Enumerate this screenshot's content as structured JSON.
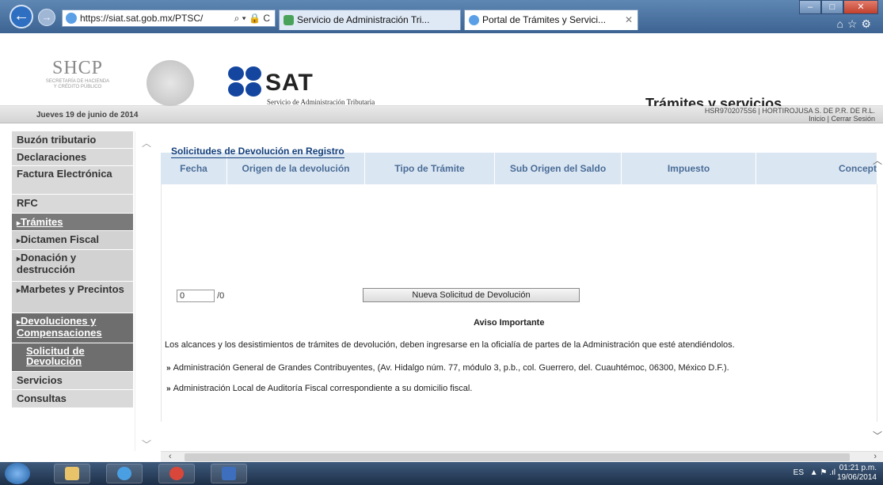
{
  "browser": {
    "url": "https://siat.sat.gob.mx/PTSC/",
    "url_controls": "⌕ ▾ 🔒 C",
    "tabs": [
      {
        "label": "Servicio de Administración Tri...",
        "active": false
      },
      {
        "label": "Portal de Trámites y Servici...",
        "active": true
      }
    ],
    "tab_close": "✕"
  },
  "header": {
    "shcp_big": "SHCP",
    "shcp_small_1": "SECRETARÍA DE HACIENDA",
    "shcp_small_2": "Y CRÉDITO PÚBLICO",
    "sat_logo": "SAT",
    "sat_subtitle": "Servicio de Administración Tributaria",
    "title": "Trámites y servicios"
  },
  "datebar": {
    "date": "Jueves 19 de junio de 2014",
    "user": "HSR9702075S6 | HORTIROJUSA S. DE P.R. DE R.L.",
    "inicio": "Inicio",
    "sep": "|",
    "cerrar": "Cerrar Sesión"
  },
  "sidebar": {
    "items": [
      {
        "label": "Buzón tributario"
      },
      {
        "label": "Declaraciones"
      },
      {
        "label": "Factura Electrónica"
      },
      {
        "label": "RFC"
      },
      {
        "label": "Trámites"
      },
      {
        "label": "Dictamen Fiscal"
      },
      {
        "label": "Donación y destrucción"
      },
      {
        "label": "Marbetes y Precintos"
      },
      {
        "label": "Devoluciones y Compensaciones"
      },
      {
        "label": "Solicitud de Devolución"
      },
      {
        "label": "Servicios"
      },
      {
        "label": "Consultas"
      }
    ]
  },
  "main": {
    "section_title": "Solicitudes de Devolución en Registro",
    "columns": [
      "Fecha",
      "Origen de la devolución",
      "Tipo de Trámite",
      "Sub Origen del Saldo",
      "Impuesto",
      "Concept"
    ],
    "pager_value": "0",
    "pager_total": "/0",
    "new_button": "Nueva Solicitud de Devolución",
    "aviso_title": "Aviso Importante",
    "aviso_text": "Los alcances y los desistimientos de trámites de devolución, deben ingresarse en la oficialía de partes de la Administración que esté atendiéndolos.",
    "bullet": "»",
    "line2": "Administración General de Grandes Contribuyentes, (Av. Hidalgo núm. 77, módulo 3, p.b., col. Guerrero, del. Cuauhtémoc, 06300, México D.F.).",
    "line3": "Administración Local de Auditoría Fiscal correspondiente a su domicilio fiscal."
  },
  "taskbar": {
    "lang": "ES",
    "time": "01:21 p.m.",
    "date": "19/06/2014"
  }
}
